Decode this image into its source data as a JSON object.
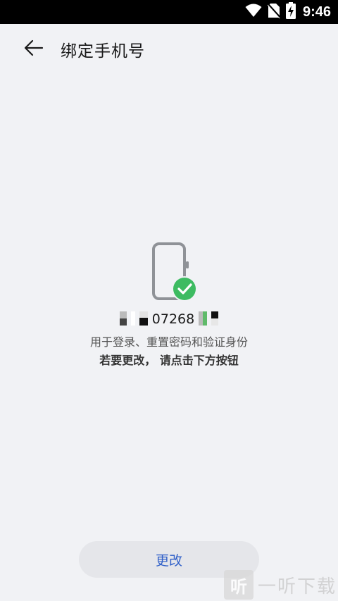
{
  "status_bar": {
    "time": "9:46",
    "icons": [
      "wifi-icon",
      "no-sim-icon",
      "battery-charging-icon"
    ]
  },
  "app_bar": {
    "back_icon": "arrow-left-icon",
    "title": "绑定手机号"
  },
  "content": {
    "illustration_icon": "phone-check-icon",
    "phone_number_visible": "07268",
    "description": "用于登录、重置密码和验证身份",
    "hint": "若要更改， 请点击下方按钮",
    "check_color": "#3dbb61"
  },
  "actions": {
    "change_label": "更改"
  },
  "watermark": {
    "badge": "听",
    "text": "一听下载"
  }
}
